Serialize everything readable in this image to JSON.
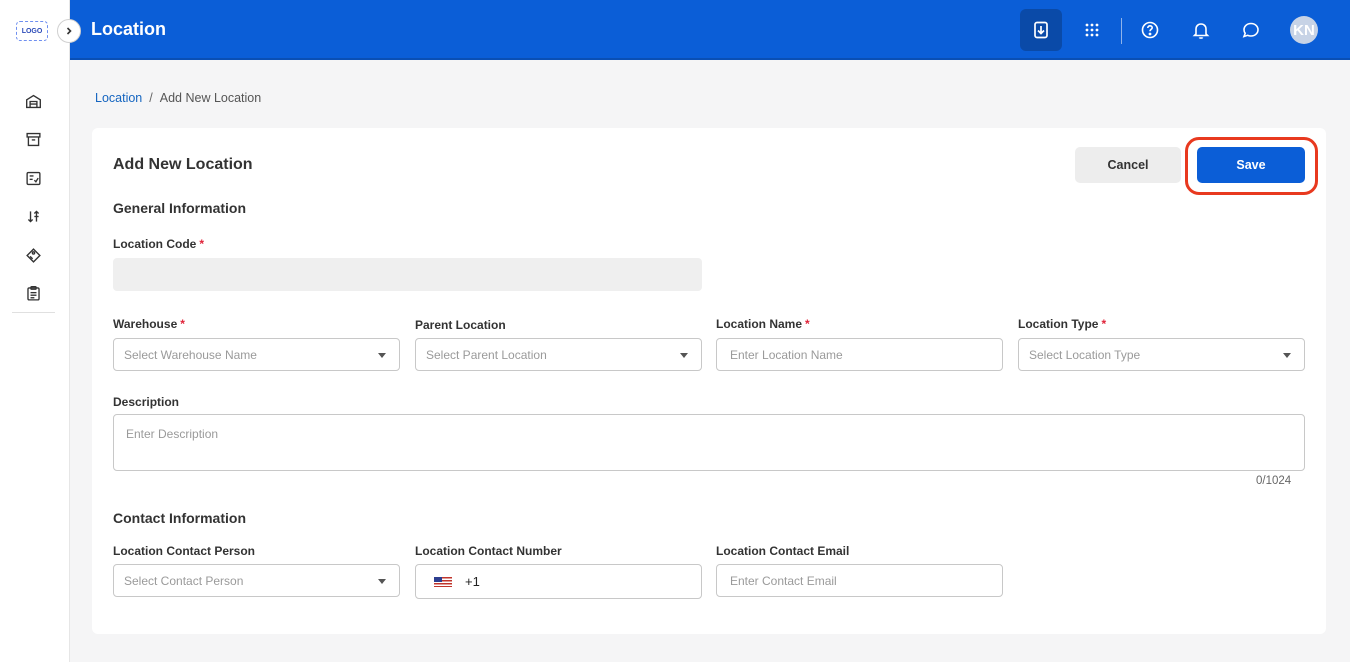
{
  "app": {
    "logo_text": "LOGO",
    "page_title": "Location",
    "user_initials": "KN"
  },
  "sidebar": {
    "items": [
      {
        "icon": "warehouse-icon"
      },
      {
        "icon": "archive-icon"
      },
      {
        "icon": "checklist-icon"
      },
      {
        "icon": "sort-icon"
      },
      {
        "icon": "tag-icon"
      },
      {
        "icon": "clipboard-icon"
      }
    ]
  },
  "header": {
    "icons": [
      "download-icon",
      "apps-grid-icon",
      "help-icon",
      "bell-icon",
      "chat-icon"
    ]
  },
  "breadcrumb": {
    "root": "Location",
    "separator": "/",
    "current": "Add New Location"
  },
  "form": {
    "title": "Add New Location",
    "cancel_label": "Cancel",
    "save_label": "Save",
    "general_section": "General Information",
    "location_code": {
      "label": "Location Code",
      "required": "*",
      "value": ""
    },
    "warehouse": {
      "label": "Warehouse",
      "required": "*",
      "placeholder": "Select Warehouse Name"
    },
    "parent_location": {
      "label": "Parent Location",
      "placeholder": "Select Parent Location"
    },
    "location_name": {
      "label": "Location Name",
      "required": "*",
      "placeholder": "Enter Location Name"
    },
    "location_type": {
      "label": "Location Type",
      "required": "*",
      "placeholder": "Select Location Type"
    },
    "description": {
      "label": "Description",
      "placeholder": "Enter Description",
      "counter": "0/1024"
    },
    "contact_section": "Contact Information",
    "contact_person": {
      "label": "Location Contact Person",
      "placeholder": "Select Contact Person"
    },
    "contact_number": {
      "label": "Location Contact Number",
      "country_code": "+1"
    },
    "contact_email": {
      "label": "Location Contact Email",
      "placeholder": "Enter Contact Email"
    }
  },
  "colors": {
    "primary": "#0b5ed7",
    "highlight_ring": "#e8391f",
    "required": "#e0243a"
  }
}
